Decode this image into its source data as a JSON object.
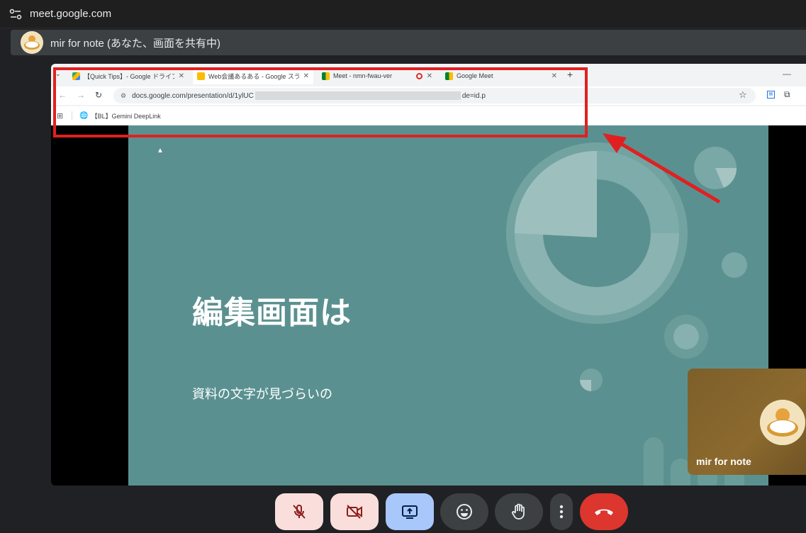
{
  "topbar": {
    "url": "meet.google.com",
    "icon": "tune-icon"
  },
  "banner": {
    "presenter_label": "mir for note (あなた、画面を共有中)",
    "icon": "avatar"
  },
  "shared_browser": {
    "tabs": [
      {
        "label": "【Quick Tips】- Google ドライブ",
        "icon": "google-drive-icon",
        "close": "✕"
      },
      {
        "label": "Web会議あるある - Google スライ",
        "icon": "google-slides-icon",
        "close": "✕",
        "active": true
      },
      {
        "label": "Meet - nmn-fwau-ver",
        "icon": "google-meet-icon",
        "close": "✕"
      },
      {
        "label": "Google Meet",
        "icon": "google-meet-icon",
        "close": "✕"
      }
    ],
    "new_tab": "+",
    "minimize": "—",
    "address": {
      "prefix": "docs.google.com/presentation/d/1ylUC",
      "suffix": "de=id.p"
    },
    "bookmark": "【BL】Gemini DeepLink"
  },
  "slide": {
    "title": "編集画面は",
    "body": "資料の文字が見づらいの",
    "background": "#5a9190"
  },
  "highlight": {
    "color": "#e02020"
  },
  "self_tile": {
    "name": "mir for note"
  },
  "controls": [
    {
      "name": "mic-off-button",
      "icon": "mic-off-icon"
    },
    {
      "name": "camera-off-button",
      "icon": "videocam-off-icon"
    },
    {
      "name": "present-button",
      "icon": "present-screen-icon"
    },
    {
      "name": "emoji-button",
      "icon": "emoji-icon"
    },
    {
      "name": "raise-hand-button",
      "icon": "hand-icon"
    },
    {
      "name": "more-options-button",
      "icon": "more-vert-icon"
    },
    {
      "name": "leave-call-button",
      "icon": "call-end-icon"
    }
  ]
}
